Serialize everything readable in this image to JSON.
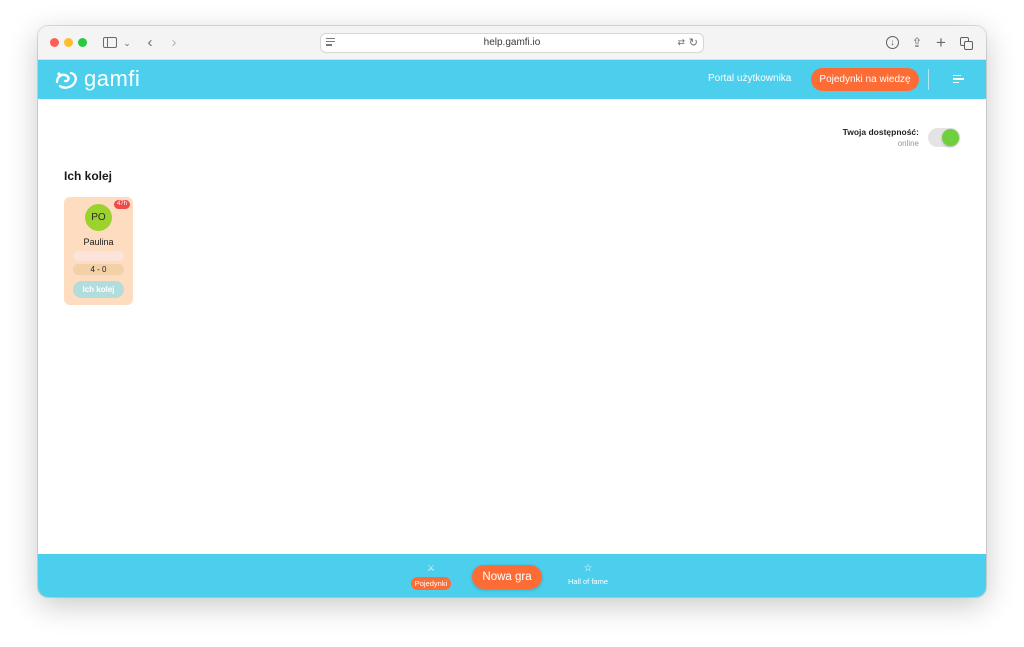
{
  "browser": {
    "url": "help.gamfi.io"
  },
  "header": {
    "logo_text": "gamfi",
    "portal_link": "Portal użytkownika",
    "duel_button": "Pojedynki na wiedzę"
  },
  "availability": {
    "label": "Twoja dostępność:",
    "status": "online",
    "enabled": true
  },
  "section": {
    "title": "Ich kolej"
  },
  "games": [
    {
      "time_badge": "47h",
      "initials": "PO",
      "name": "Paulina",
      "score": "4 - 0",
      "button": "Ich kolej"
    }
  ],
  "footer": {
    "duels_label": "Pojedynki",
    "new_game_label": "Nowa gra",
    "hall_label": "Hall of fame"
  },
  "colors": {
    "brand": "#4bcfec",
    "accent": "#fc6c34",
    "card": "#fddcc0",
    "avatar": "#9bd22e",
    "toggle_on": "#6fcf3e"
  }
}
